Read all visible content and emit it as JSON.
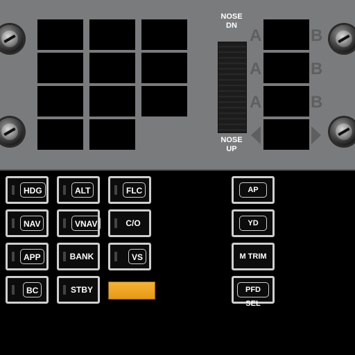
{
  "trim": {
    "nose_dn": "NOSE\nDN",
    "nose_up": "NOSE\nUP"
  },
  "channels": [
    {
      "a": "A",
      "b": "B"
    },
    {
      "a": "A",
      "b": "B"
    },
    {
      "a": "A",
      "b": "B"
    }
  ],
  "buttons": [
    {
      "label": "HDG",
      "boxed": true
    },
    {
      "label": "ALT",
      "boxed": true
    },
    {
      "label": "FLC",
      "boxed": true
    },
    {
      "label": "NAV",
      "boxed": true
    },
    {
      "label": "VNAV",
      "boxed": true
    },
    {
      "label": "C/O",
      "boxed": false
    },
    {
      "label": "APP",
      "boxed": true
    },
    {
      "label": "BANK",
      "boxed": false
    },
    {
      "label": "VS",
      "boxed": true
    },
    {
      "label": "BC",
      "boxed": true
    },
    {
      "label": "STBY",
      "boxed": false
    }
  ],
  "right_buttons": [
    {
      "label": "AP",
      "boxed": true
    },
    {
      "label": "YD",
      "boxed": true
    },
    {
      "label": "M TRIM",
      "boxed": false
    },
    {
      "label": "PFD SEL",
      "boxed": true
    }
  ],
  "colors": {
    "panel": "#7a7b7d",
    "amber": "#f0a82a",
    "button_border": "#cfcfcf"
  }
}
